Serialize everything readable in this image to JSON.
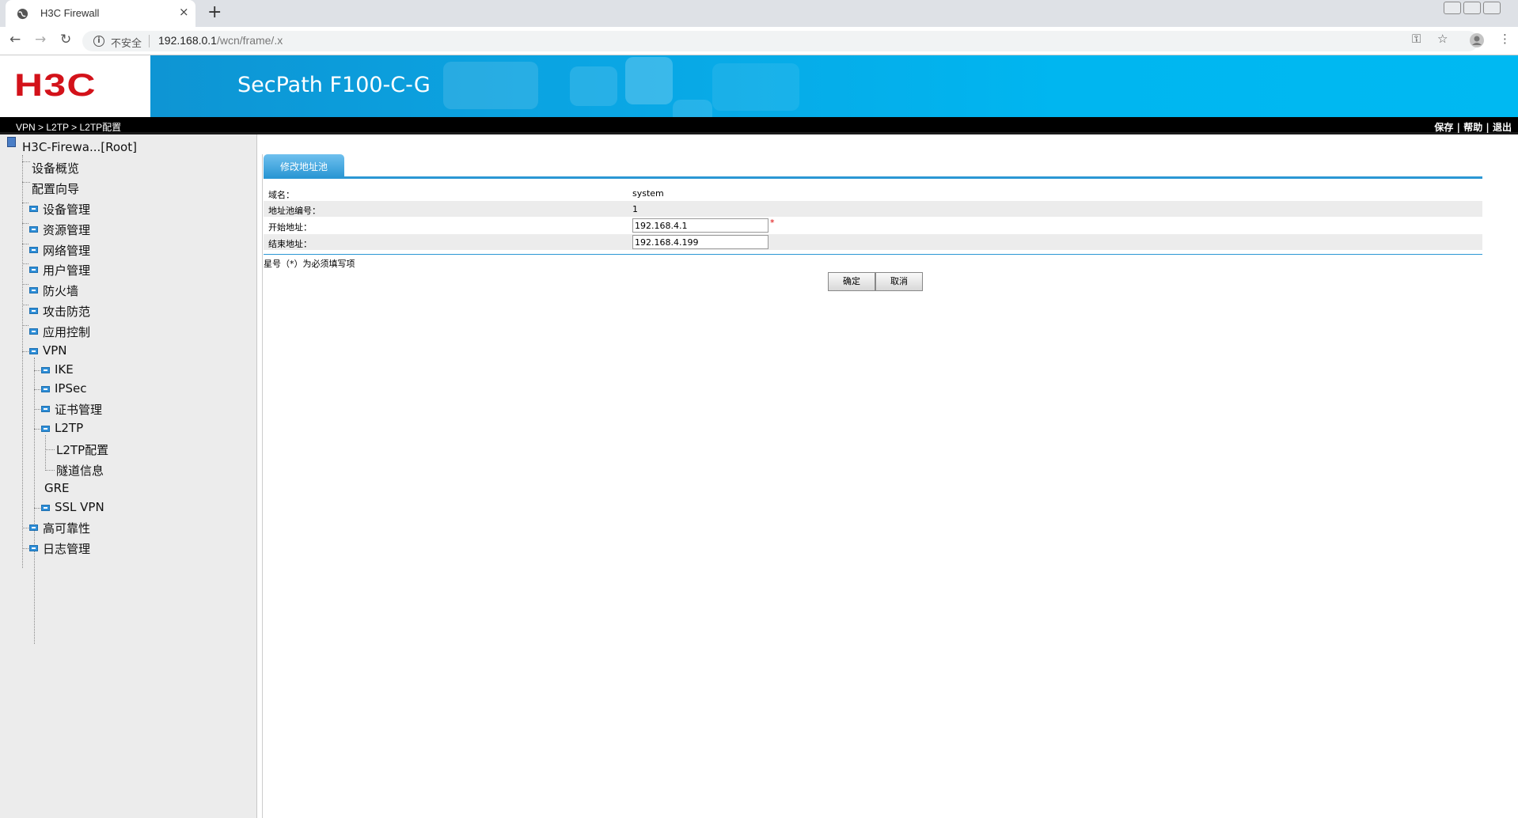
{
  "browser": {
    "tab_title": "H3C Firewall",
    "new_tab_label": "+",
    "close_tab_label": "×",
    "security_label": "不安全",
    "url_host": "192.168.0.1",
    "url_path": "/wcn/frame/.x"
  },
  "header": {
    "logo_text": "H3C",
    "product_name": "SecPath F100-C-G",
    "breadcrumb": "VPN > L2TP > L2TP配置",
    "links": [
      "保存",
      "帮助",
      "退出"
    ],
    "link_separator": "|"
  },
  "sidebar": {
    "root": "H3C-Firewa...[Root]",
    "items": [
      {
        "label": "设备概览"
      },
      {
        "label": "配置向导"
      },
      {
        "label": "设备管理"
      },
      {
        "label": "资源管理"
      },
      {
        "label": "网络管理"
      },
      {
        "label": "用户管理"
      },
      {
        "label": "防火墙"
      },
      {
        "label": "攻击防范"
      },
      {
        "label": "应用控制"
      },
      {
        "label": "VPN"
      },
      {
        "label": "IKE"
      },
      {
        "label": "IPSec"
      },
      {
        "label": "证书管理"
      },
      {
        "label": "L2TP"
      },
      {
        "label": "L2TP配置"
      },
      {
        "label": "隧道信息"
      },
      {
        "label": "GRE"
      },
      {
        "label": "SSL VPN"
      },
      {
        "label": "高可靠性"
      },
      {
        "label": "日志管理"
      }
    ]
  },
  "form": {
    "tab_label": "修改地址池",
    "rows": [
      {
        "label": "域名：",
        "value": "system"
      },
      {
        "label": "地址池编号：",
        "value": "1"
      },
      {
        "label": "开始地址：",
        "value": "192.168.4.1"
      },
      {
        "label": "结束地址：",
        "value": "192.168.4.199"
      }
    ],
    "required_mark": "*",
    "note": "星号（*）为必须填写项",
    "ok_label": "确定",
    "cancel_label": "取消"
  },
  "colors": {
    "header_blue": "#00b6f0",
    "logo_red": "#d3121a",
    "tab_blue": "#2b97d4"
  }
}
